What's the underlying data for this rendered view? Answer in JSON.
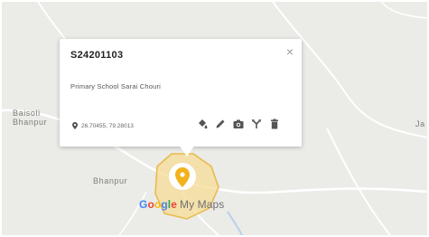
{
  "map": {
    "labels": {
      "baisoli": [
        "Baisoli",
        "Bhanpur"
      ],
      "right_edge": "Ja",
      "bhanpur": "Bhanpur"
    },
    "colors": {
      "land": "#ebebe8",
      "road": "#ffffff",
      "polygon_fill": "#f6dc96",
      "polygon_stroke": "#e9b949",
      "marker": "#f2b21c",
      "river": "#b9d1ea"
    }
  },
  "popup": {
    "title": "S24201103",
    "close_glyph": "×",
    "description": "Primary School Sarai Chouri",
    "coordinates": "26.70455, 79.28013",
    "tools": [
      "paint-bucket-icon",
      "pencil-icon",
      "camera-icon",
      "directions-icon",
      "trash-icon"
    ]
  },
  "branding": {
    "google": [
      "G",
      "o",
      "o",
      "g",
      "l",
      "e"
    ],
    "google_colors": [
      "#4285f4",
      "#ea4335",
      "#fbbc05",
      "#4285f4",
      "#34a853",
      "#ea4335"
    ],
    "product": "My Maps"
  }
}
